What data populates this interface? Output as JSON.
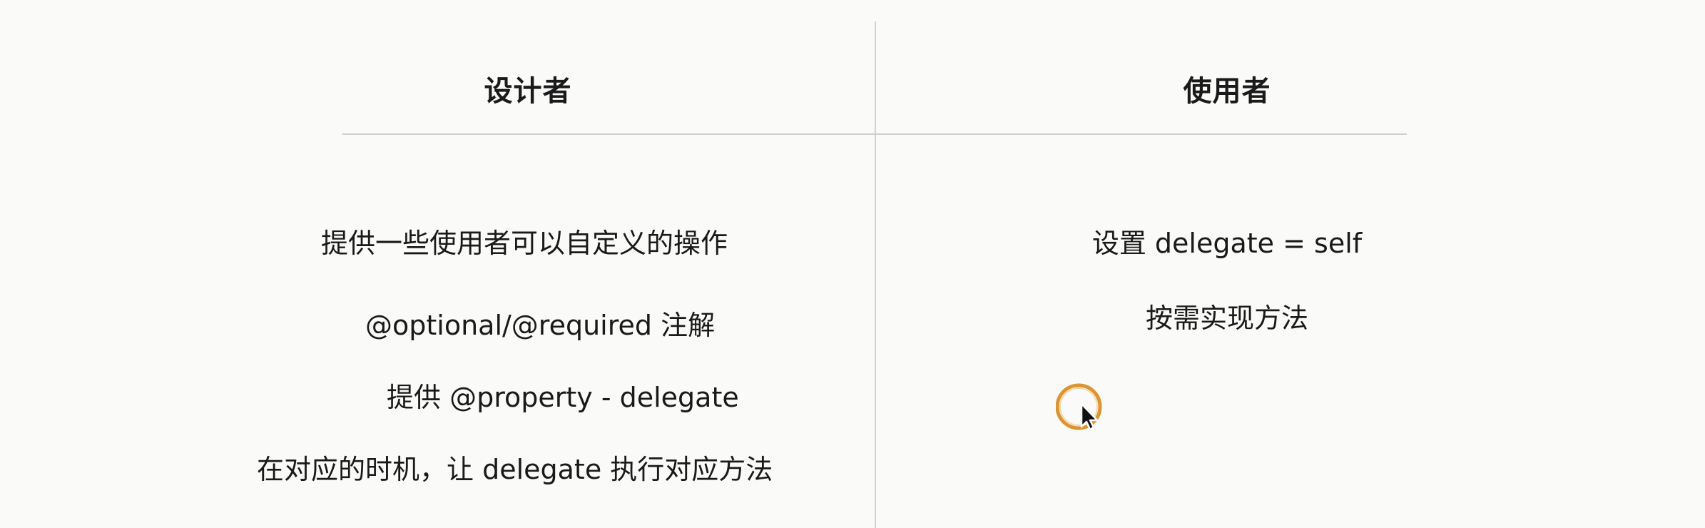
{
  "left": {
    "header": "设计者",
    "items": [
      "提供一些使用者可以自定义的操作",
      "@optional/@required 注解",
      "提供 @property - delegate",
      "在对应的时机，让 delegate 执行对应方法"
    ]
  },
  "right": {
    "header": "使用者",
    "items": [
      "设置 delegate = self",
      "按需实现方法"
    ]
  },
  "colors": {
    "background": "#fafaf8",
    "divider": "#d0d0d0",
    "text": "#1a1a1a",
    "cursor_ring": "#d98a1e"
  },
  "icons": {
    "cursor": "mouse-pointer-icon"
  }
}
